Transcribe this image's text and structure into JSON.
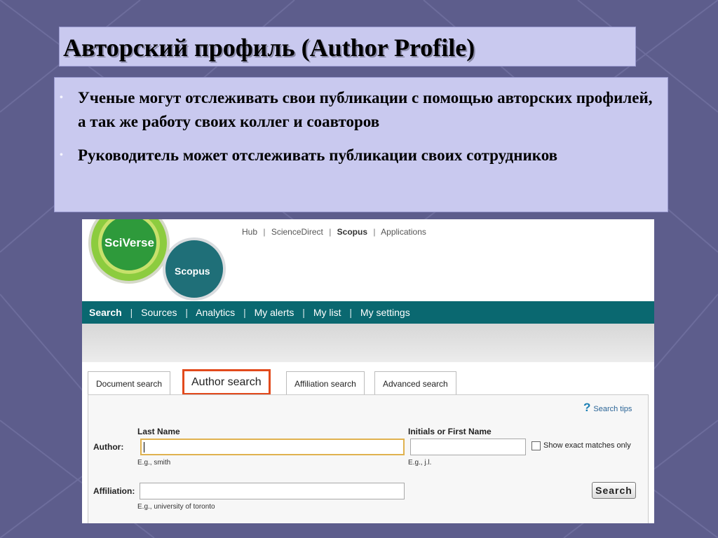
{
  "slide": {
    "title": "Авторский профиль (Author Profile)",
    "bullets": [
      "Ученые могут отслеживать свои публикации с помощью авторских профилей, а так же работу своих коллег и соавторов",
      "Руководитель может отслеживать публикации своих сотрудников"
    ],
    "bullet_marker": "•"
  },
  "scopus": {
    "logos": {
      "sciverse": "SciVerse",
      "scopus": "Scopus"
    },
    "hub_links": [
      {
        "label": "Hub",
        "bold": false
      },
      {
        "label": "ScienceDirect",
        "bold": false
      },
      {
        "label": "Scopus",
        "bold": true
      },
      {
        "label": "Applications",
        "bold": false
      }
    ],
    "nav": [
      {
        "label": "Search",
        "active": true
      },
      {
        "label": "Sources",
        "active": false
      },
      {
        "label": "Analytics",
        "active": false
      },
      {
        "label": "My alerts",
        "active": false
      },
      {
        "label": "My list",
        "active": false
      },
      {
        "label": "My settings",
        "active": false
      }
    ],
    "separator": "|",
    "tabs": {
      "document": "Document search",
      "author": "Author search",
      "affiliation": "Affiliation search",
      "advanced": "Advanced search"
    },
    "search_tips": "Search tips",
    "help_icon": "question-mark-icon",
    "form": {
      "author_label": "Author:",
      "last_name_label": "Last Name",
      "last_name_value": "",
      "last_name_hint": "E.g., smith",
      "first_name_label": "Initials or First Name",
      "first_name_value": "",
      "first_name_hint": "E.g., j.l.",
      "exact_matches_label": "Show exact matches only",
      "exact_matches_checked": false,
      "affiliation_label": "Affiliation:",
      "affiliation_value": "",
      "affiliation_hint": "E.g., university of toronto",
      "search_button": "Search"
    },
    "colors": {
      "nav_bar": "#0a6870",
      "tab_highlight": "#e24a1c",
      "slide_box": "#c9c9ef",
      "background": "#5d5d8c"
    }
  }
}
